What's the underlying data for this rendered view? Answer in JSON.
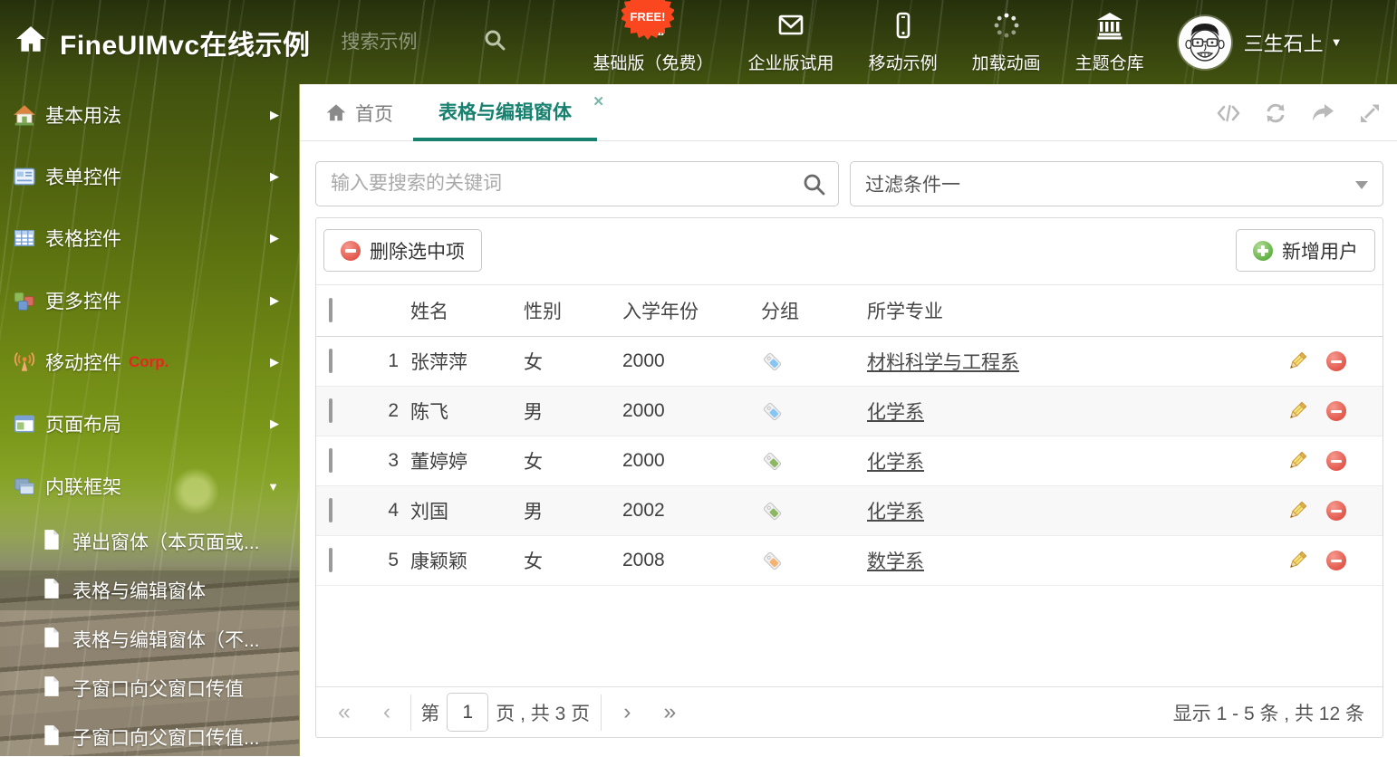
{
  "header": {
    "title": "FineUIMvc在线示例",
    "search_placeholder": "搜索示例",
    "free_badge": "FREE!",
    "nav": [
      {
        "label": "基础版（免费）",
        "icon": "download-icon"
      },
      {
        "label": "企业版试用",
        "icon": "envelope-icon"
      },
      {
        "label": "移动示例",
        "icon": "mobile-icon"
      },
      {
        "label": "加载动画",
        "icon": "spinner-icon"
      },
      {
        "label": "主题仓库",
        "icon": "bank-icon"
      }
    ],
    "user": {
      "name": "三生石上"
    }
  },
  "sidebar": {
    "items": [
      {
        "label": "基本用法"
      },
      {
        "label": "表单控件"
      },
      {
        "label": "表格控件"
      },
      {
        "label": "更多控件"
      },
      {
        "label": "移动控件",
        "badge": "Corp."
      },
      {
        "label": "页面布局"
      },
      {
        "label": "内联框架"
      }
    ],
    "subitems": [
      {
        "label": "弹出窗体（本页面或..."
      },
      {
        "label": "表格与编辑窗体"
      },
      {
        "label": "表格与编辑窗体（不..."
      },
      {
        "label": "子窗口向父窗口传值"
      },
      {
        "label": "子窗口向父窗口传值..."
      }
    ]
  },
  "tabs": {
    "home": "首页",
    "active": "表格与编辑窗体",
    "close": "✕"
  },
  "filters": {
    "search_placeholder": "输入要搜索的关键词",
    "filter_value": "过滤条件一"
  },
  "toolbar": {
    "delete_label": "删除选中项",
    "add_label": "新增用户"
  },
  "table": {
    "columns": {
      "name": "姓名",
      "gender": "性别",
      "year": "入学年份",
      "group": "分组",
      "major": "所学专业"
    },
    "rows": [
      {
        "num": "1",
        "name": "张萍萍",
        "gender": "女",
        "year": "2000",
        "tag_color": "#86c5f4",
        "major": "材料科学与工程系"
      },
      {
        "num": "2",
        "name": "陈飞",
        "gender": "男",
        "year": "2000",
        "tag_color": "#86c5f4",
        "major": "化学系"
      },
      {
        "num": "3",
        "name": "董婷婷",
        "gender": "女",
        "year": "2000",
        "tag_color": "#8cb865",
        "major": "化学系"
      },
      {
        "num": "4",
        "name": "刘国",
        "gender": "男",
        "year": "2002",
        "tag_color": "#8cb865",
        "major": "化学系"
      },
      {
        "num": "5",
        "name": "康颖颖",
        "gender": "女",
        "year": "2008",
        "tag_color": "#f6b26f",
        "major": "数学系"
      }
    ]
  },
  "pagination": {
    "first": "«",
    "prev": "‹",
    "next": "›",
    "last": "»",
    "prefix": "第",
    "current_page": "1",
    "suffix": "页 , 共 3 页",
    "summary": "显示 1 - 5 条 , 共 12 条"
  },
  "colors": {
    "accent": "#17806e",
    "delete_red": "#e2564a",
    "add_green": "#5fae41",
    "free_orange": "#fb471f"
  }
}
